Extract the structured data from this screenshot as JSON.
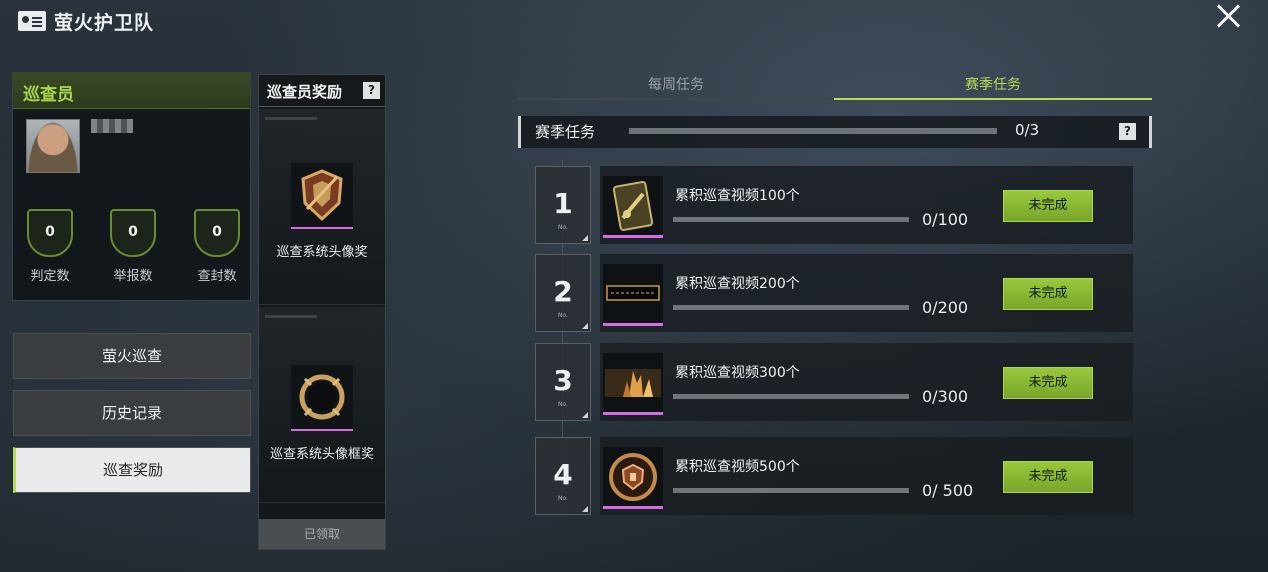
{
  "header": {
    "title": "萤火护卫队"
  },
  "card": {
    "role": "巡查员",
    "stats": [
      {
        "value": "0",
        "label": "判定数"
      },
      {
        "value": "0",
        "label": "举报数"
      },
      {
        "value": "0",
        "label": "查封数"
      }
    ]
  },
  "menu": {
    "items": [
      {
        "label": "萤火巡查"
      },
      {
        "label": "历史记录"
      },
      {
        "label": "巡查奖励"
      }
    ],
    "active_index": 2
  },
  "rewards": {
    "title": "巡查员奖励",
    "help": "?",
    "items": [
      {
        "name": "巡查系统头像奖",
        "icon": "shield-avatar-icon"
      },
      {
        "name": "巡查系统头像框奖",
        "icon": "avatar-frame-icon"
      }
    ],
    "claimed_label": "已领取"
  },
  "tabs": {
    "weekly": "每周任务",
    "season": "赛季任务",
    "active": "season"
  },
  "season": {
    "title": "赛季任务",
    "progress": "0/3",
    "progress_fraction": 0,
    "help": "?"
  },
  "tasks": [
    {
      "no": "1",
      "no_label": "No.",
      "name": "累积巡查视频100个",
      "progress": "0/100",
      "fraction": 0,
      "status": "未完成",
      "icon": "card-badge-icon"
    },
    {
      "no": "2",
      "no_label": "No.",
      "name": "累积巡查视频200个",
      "progress": "0/200",
      "fraction": 0,
      "status": "未完成",
      "icon": "nameplate-banner-icon"
    },
    {
      "no": "3",
      "no_label": "No.",
      "name": "累积巡查视频300个",
      "progress": "0/300",
      "fraction": 0,
      "status": "未完成",
      "icon": "flame-banner-icon"
    },
    {
      "no": "4",
      "no_label": "No.",
      "name": "累积巡查视频500个",
      "progress": "0/ 500",
      "fraction": 0,
      "status": "未完成",
      "icon": "emblem-badge-icon"
    }
  ],
  "colors": {
    "accent": "#b7dc57",
    "rarity": "#d46be0",
    "button": "#8ab834"
  }
}
